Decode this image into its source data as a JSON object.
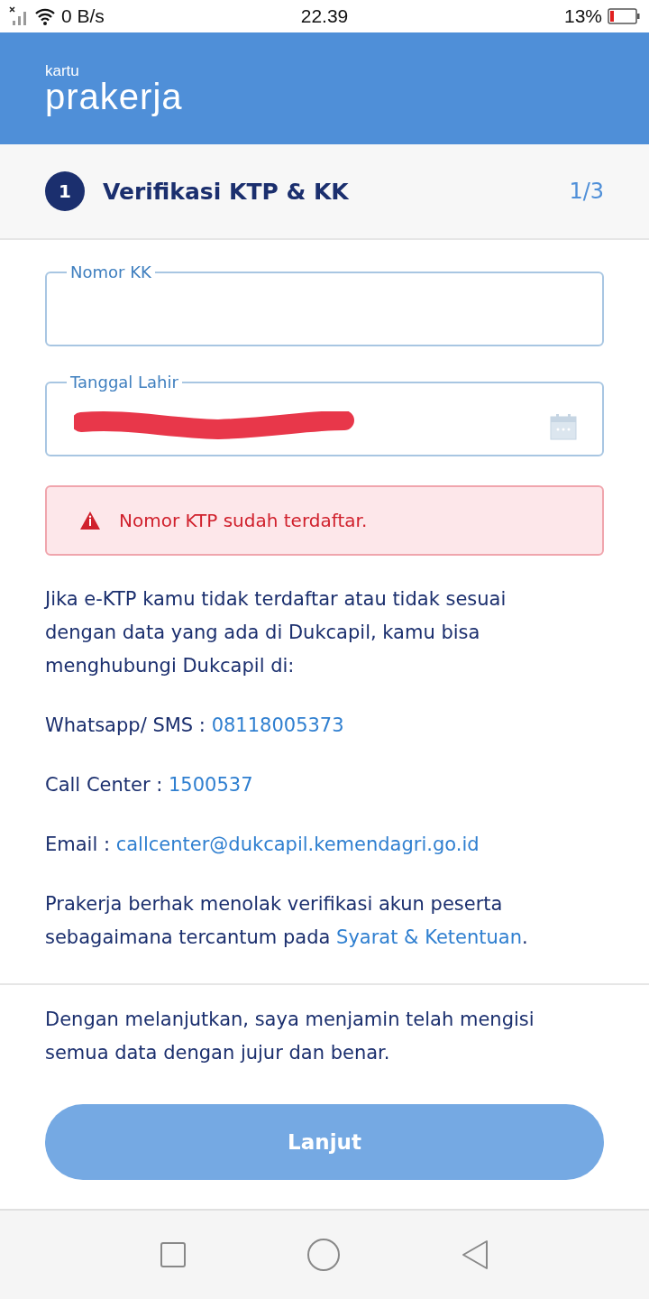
{
  "status_bar": {
    "network_speed": "0 B/s",
    "time": "22.39",
    "battery": "13%"
  },
  "header": {
    "logo_small": "kartu",
    "logo_big": "prakerja"
  },
  "step": {
    "number": "1",
    "title": "Verifikasi KTP & KK",
    "counter": "1/3"
  },
  "fields": [
    {
      "label": "Nomor KK",
      "kind": "text"
    },
    {
      "label": "Tanggal Lahir",
      "kind": "date",
      "redacted": true
    }
  ],
  "error": {
    "message": "Nomor KTP sudah terdaftar."
  },
  "info": "Jika e-KTP kamu tidak terdaftar atau tidak sesuai dengan data yang ada di Dukcapil, kamu bisa menghubungi Dukcapil di:",
  "contacts": [
    {
      "label": "Whatsapp/ SMS :",
      "value": "08118005373"
    },
    {
      "label": "Call Center :",
      "value": "1500537"
    },
    {
      "label": "Email :",
      "value": "callcenter@dukcapil.kemendagri.go.id"
    }
  ],
  "terms": {
    "before": "Prakerja berhak menolak verifikasi akun peserta sebagaimana tercantum pada ",
    "link": "Syarat & Ketentuan",
    "after": "."
  },
  "agreement": "Dengan melanjutkan, saya menjamin telah mengisi semua data dengan jujur dan benar.",
  "button": {
    "label": "Lanjut",
    "disabled": true
  }
}
